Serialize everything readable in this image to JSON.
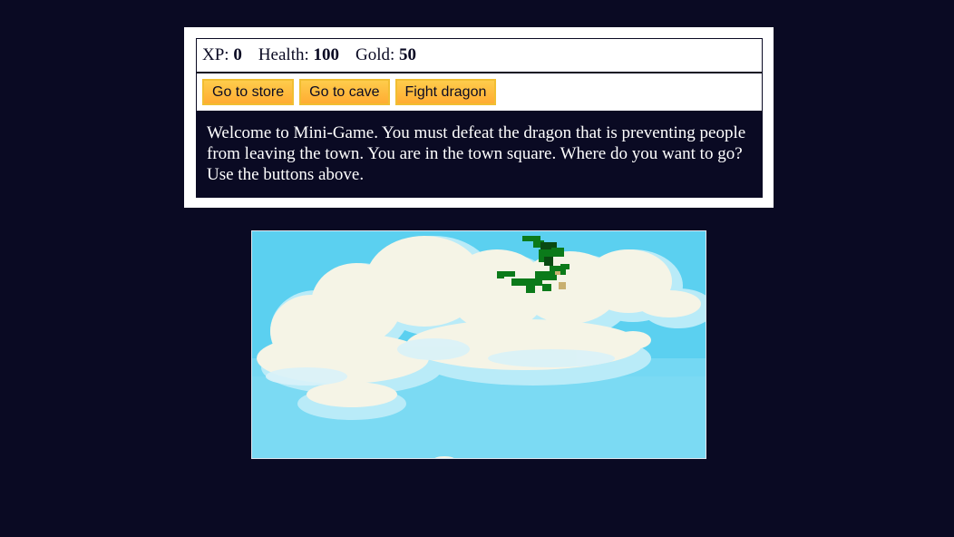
{
  "stats": {
    "xp_label": "XP:",
    "xp_value": "0",
    "health_label": "Health:",
    "health_value": "100",
    "gold_label": "Gold:",
    "gold_value": "50"
  },
  "controls": {
    "button1": "Go to store",
    "button2": "Go to cave",
    "button3": "Fight dragon"
  },
  "text": "Welcome to Mini-Game. You must defeat the dragon that is preventing people from leaving the town. You are in the town square. Where do you want to go? Use the buttons above.",
  "colors": {
    "page_bg": "#0a0a23",
    "button_bg": "#feac32",
    "sky": "#5bd0f0",
    "cloud": "#f5f4e6",
    "dragon": "#0b7a1a"
  },
  "icons": {
    "dragon": "dragon-sprite",
    "clouds": "cloud-scene"
  }
}
